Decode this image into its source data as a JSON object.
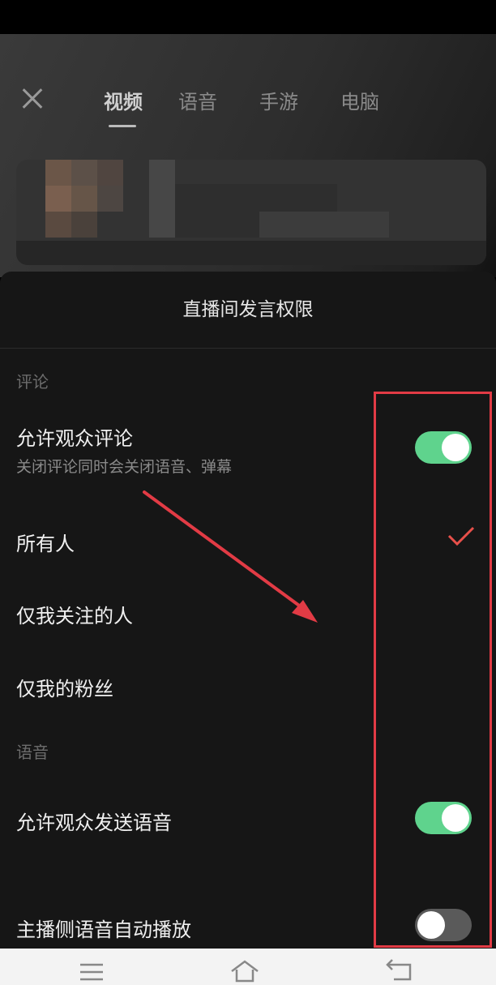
{
  "header": {
    "close_icon": "close-icon",
    "tabs": [
      {
        "label": "视频",
        "active": true
      },
      {
        "label": "语音",
        "active": false
      },
      {
        "label": "手游",
        "active": false
      },
      {
        "label": "电脑",
        "active": false
      }
    ]
  },
  "sheet": {
    "title": "直播间发言权限",
    "comment_section": {
      "label": "评论",
      "allow_comments": {
        "title": "允许观众评论",
        "subtitle": "关闭评论同时会关闭语音、弹幕",
        "enabled": true
      },
      "options": [
        {
          "label": "所有人",
          "selected": true
        },
        {
          "label": "仅我关注的人",
          "selected": false
        },
        {
          "label": "仅我的粉丝",
          "selected": false
        }
      ]
    },
    "voice_section": {
      "label": "语音",
      "allow_voice": {
        "title": "允许观众发送语音",
        "enabled": true
      },
      "auto_play": {
        "title": "主播侧语音自动播放",
        "enabled": false
      }
    }
  },
  "colors": {
    "toggle_on": "#5fd38d",
    "toggle_off": "#5a5a5a",
    "check": "#e8504a",
    "annotation": "#e23b45"
  },
  "navbar": {
    "icons": [
      "menu-icon",
      "home-icon",
      "back-icon"
    ]
  }
}
